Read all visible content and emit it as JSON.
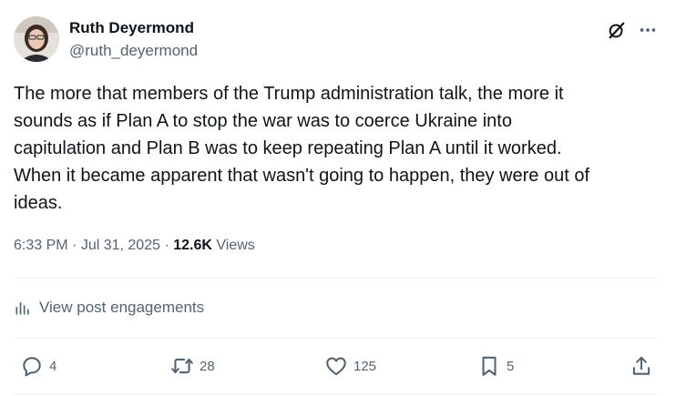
{
  "author": {
    "display_name": "Ruth Deyermond",
    "handle": "@ruth_deyermond"
  },
  "post": {
    "text": "The more that members of the Trump administration talk, the more it\nsounds as if Plan A to stop the war was to coerce Ukraine into\ncapitulation and Plan B was to keep repeating Plan A until it worked.\nWhen it became apparent that wasn't going to happen, they were out of\nideas."
  },
  "meta": {
    "time": "6:33 PM",
    "separator": " · ",
    "date": "Jul 31, 2025",
    "separator2": " · ",
    "views_count": "12.6K",
    "views_label": " Views"
  },
  "engagements": {
    "label": "View post engagements"
  },
  "actions": {
    "replies": "4",
    "reposts": "28",
    "likes": "125",
    "bookmarks": "5"
  },
  "icons": {
    "grok": "grok-icon",
    "more": "more-icon",
    "analytics": "analytics-icon",
    "reply": "reply-icon",
    "repost": "repost-icon",
    "like": "heart-icon",
    "bookmark": "bookmark-icon",
    "share": "share-icon"
  },
  "colors": {
    "text_primary": "#0f1419",
    "text_secondary": "#536471",
    "divider": "#eff3f4"
  }
}
